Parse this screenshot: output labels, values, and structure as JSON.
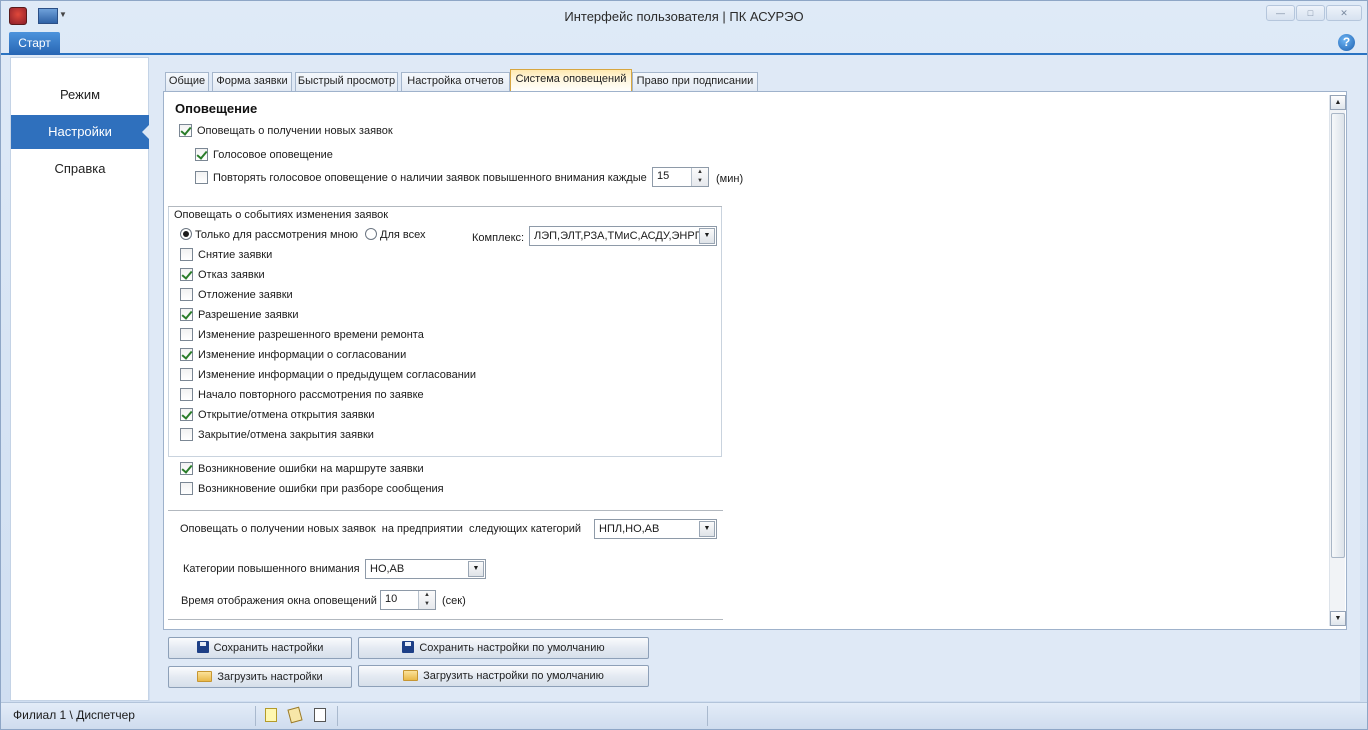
{
  "window": {
    "title": "Интерфейс пользователя | ПК АСУРЭО"
  },
  "ribbon": {
    "start_tab": "Старт",
    "help": "?"
  },
  "nav": {
    "items": [
      {
        "label": "Режим"
      },
      {
        "label": "Настройки"
      },
      {
        "label": "Справка"
      }
    ],
    "selected": "Настройки"
  },
  "tabs": [
    {
      "label": "Общие"
    },
    {
      "label": "Форма заявки"
    },
    {
      "label": "Быстрый просмотр"
    },
    {
      "label": "Настройка отчетов"
    },
    {
      "label": "Система оповещений"
    },
    {
      "label": "Право при подписании"
    }
  ],
  "active_tab": "Система оповещений",
  "notify": {
    "heading": "Оповещение",
    "new_requests": {
      "label": "Оповещать о получении новых заявок",
      "checked": true
    },
    "voice": {
      "label": "Голосовое оповещение",
      "checked": true
    },
    "repeat": {
      "label": "Повторять голосовое оповещение о наличии заявок повышенного внимания каждые",
      "checked": false,
      "value": "15",
      "unit": "(мин)"
    }
  },
  "events": {
    "group_title": "Оповещать о событиях изменения заявок",
    "radio_mine": "Только для рассмотрения мною",
    "radio_all": "Для всех",
    "radio_selected": "Только для рассмотрения мною",
    "complex_label": "Комплекс:",
    "complex_value": "ЛЭП,ЭЛТ,РЗА,ТМиС,АСДУ,ЭНРГ,:",
    "items": [
      {
        "label": "Снятие заявки",
        "checked": false
      },
      {
        "label": "Отказ заявки",
        "checked": true
      },
      {
        "label": "Отложение заявки",
        "checked": false
      },
      {
        "label": "Разрешение заявки",
        "checked": true
      },
      {
        "label": "Изменение разрешенного времени ремонта",
        "checked": false
      },
      {
        "label": "Изменение информации о согласовании",
        "checked": true
      },
      {
        "label": "Изменение информации о предыдущем согласовании",
        "checked": false
      },
      {
        "label": "Начало повторного рассмотрения по заявке",
        "checked": false
      },
      {
        "label": "Открытие/отмена открытия заявки",
        "checked": true
      },
      {
        "label": "Закрытие/отмена закрытия заявки",
        "checked": false
      }
    ]
  },
  "errors": [
    {
      "label": "Возникновение ошибки на маршруте заявки",
      "checked": true
    },
    {
      "label": "Возникновение ошибки при разборе сообщения",
      "checked": false
    }
  ],
  "categories": {
    "label": "Оповещать о получении новых заявок  на предприятии  следующих категорий",
    "value": "НПЛ,НО,АВ",
    "attention_label": "Категории повышенного внимания",
    "attention_value": "НО,АВ",
    "display_time_label": "Время отображения окна оповещений",
    "display_time_value": "10",
    "display_time_unit": "(сек)"
  },
  "buttons": {
    "save": "Сохранить настройки",
    "save_default": "Сохранить настройки по умолчанию",
    "load": "Загрузить настройки",
    "load_default": "Загрузить настройки по умолчанию"
  },
  "status": {
    "text": "Филиал 1 \\ Диспетчер"
  }
}
